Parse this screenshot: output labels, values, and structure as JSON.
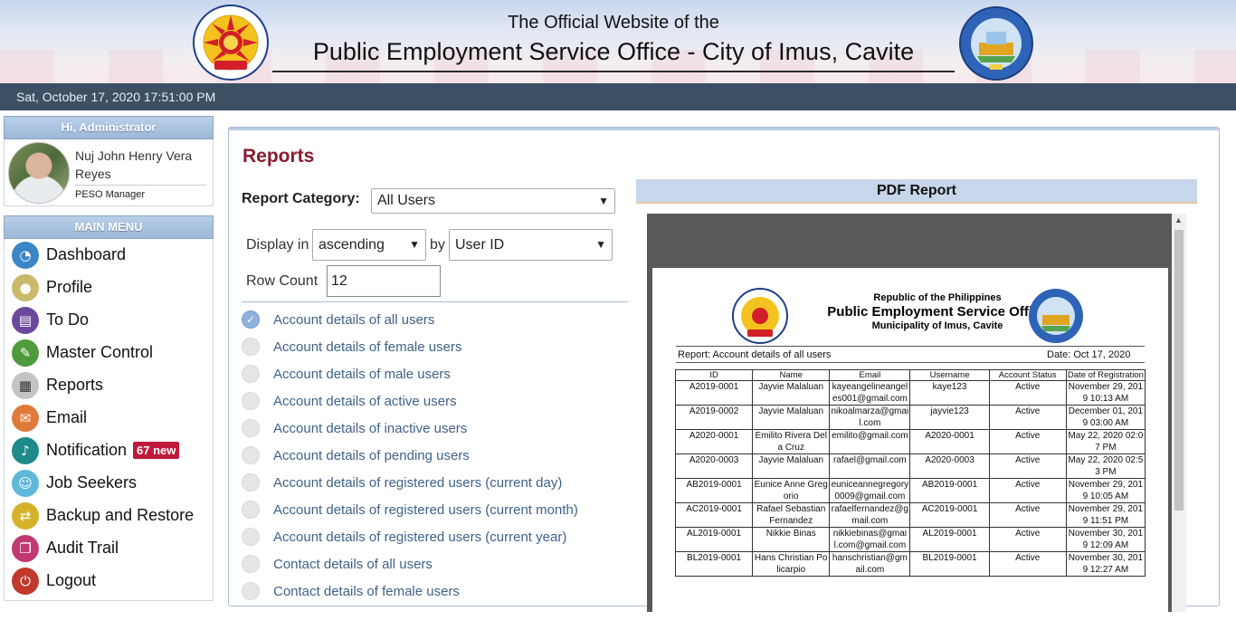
{
  "header": {
    "line1": "The Official Website of the",
    "line2": "Public Employment Service Office - City of Imus, Cavite",
    "peso_logo_text": "PUBLIC EMPLOYMENT SERVICE OFFICE · P.E.S.O.",
    "imus_logo_text": "LUNGSOD NG IMUS · LALAWIGAN NG CAVITE · 2012"
  },
  "datetime": "Sat, October 17, 2020 17:51:00 PM",
  "user": {
    "greeting": "Hi, Administrator",
    "name": "Nuj John Henry Vera Reyes",
    "role": "PESO Manager"
  },
  "menu": {
    "header": "MAIN MENU",
    "items": [
      {
        "label": "Dashboard",
        "icon": "dashboard-icon",
        "color": "#3a86c8"
      },
      {
        "label": "Profile",
        "icon": "user-icon",
        "color": "#c9b96b"
      },
      {
        "label": "To Do",
        "icon": "document-icon",
        "color": "#6b4a9e"
      },
      {
        "label": "Master Control",
        "icon": "wrench-icon",
        "color": "#4f9a3c"
      },
      {
        "label": "Reports",
        "icon": "table-icon",
        "color": "#c4c4c4"
      },
      {
        "label": "Email",
        "icon": "envelope-icon",
        "color": "#e07a3a"
      },
      {
        "label": "Notification",
        "icon": "bell-icon",
        "color": "#1f8a8a"
      },
      {
        "label": "Job Seekers",
        "icon": "people-icon",
        "color": "#5fb8d8"
      },
      {
        "label": "Backup and Restore",
        "icon": "transfer-icon",
        "color": "#d6b22a"
      },
      {
        "label": "Audit Trail",
        "icon": "copy-icon",
        "color": "#c2396f"
      },
      {
        "label": "Logout",
        "icon": "power-icon",
        "color": "#c0392b"
      }
    ],
    "notification_badge": "67 new"
  },
  "reports": {
    "title": "Reports",
    "category_label": "Report Category:",
    "category_value": "All Users",
    "display_label": "Display in",
    "order_value": "ascending",
    "by_label": "by",
    "sort_value": "User ID",
    "row_count_label": "Row Count",
    "row_count_value": "12",
    "options": [
      {
        "label": "Account details of all users",
        "selected": true
      },
      {
        "label": "Account details of female users",
        "selected": false
      },
      {
        "label": "Account details of male users",
        "selected": false
      },
      {
        "label": "Account details of active users",
        "selected": false
      },
      {
        "label": "Account details of inactive users",
        "selected": false
      },
      {
        "label": "Account details of pending users",
        "selected": false
      },
      {
        "label": "Account details of registered users (current day)",
        "selected": false
      },
      {
        "label": "Account details of registered users (current month)",
        "selected": false
      },
      {
        "label": "Account details of registered users (current year)",
        "selected": false
      },
      {
        "label": "Contact details of all users",
        "selected": false
      },
      {
        "label": "Contact details of female users",
        "selected": false
      }
    ]
  },
  "pdf": {
    "header": "PDF Report",
    "republic": "Republic of the Philippines",
    "office": "Public Employment Service Office",
    "municipality": "Municipality of Imus, Cavite",
    "report_label": "Report: Account details of all users",
    "date_label": "Date: Oct 17, 2020",
    "columns": [
      "ID",
      "Name",
      "Email",
      "Username",
      "Account Status",
      "Date of Registration"
    ],
    "rows": [
      [
        "A2019-0001",
        "Jayvie  Malaluan",
        "kayeangelineangeles001@gmail.com",
        "kaye123",
        "Active",
        "November 29, 2019 10:13 AM"
      ],
      [
        "A2019-0002",
        "Jayvie  Malaluan",
        "nikoalmarza@gmail.com",
        "jayvie123",
        "Active",
        "December 01, 2019 03:00 AM"
      ],
      [
        "A2020-0001",
        "Emilito Rivera Dela Cruz",
        "emilito@gmail.com",
        "A2020-0001",
        "Active",
        "May 22, 2020 02:07 PM"
      ],
      [
        "A2020-0003",
        "Jayvie  Malaluan",
        "rafael@gmail.com",
        "A2020-0003",
        "Active",
        "May 22, 2020 02:53 PM"
      ],
      [
        "AB2019-0001",
        "Eunice Anne Gregorio",
        "euniceannegregory0009@gmail.com",
        "AB2019-0001",
        "Active",
        "November 29, 2019 10:05 AM"
      ],
      [
        "AC2019-0001",
        "Rafael Sebastian Fernandez",
        "rafaelfernandez@gmail.com",
        "AC2019-0001",
        "Active",
        "November 29, 2019 11:51 PM"
      ],
      [
        "AL2019-0001",
        "Nikkie  Binas",
        "nikkiebinas@gmail.com@gmail.com",
        "AL2019-0001",
        "Active",
        "November 30, 2019 12:09 AM"
      ],
      [
        "BL2019-0001",
        "Hans Christian Policarpio",
        "hanschristian@gmail.com",
        "BL2019-0001",
        "Active",
        "November 30, 2019 12:27 AM"
      ]
    ]
  }
}
